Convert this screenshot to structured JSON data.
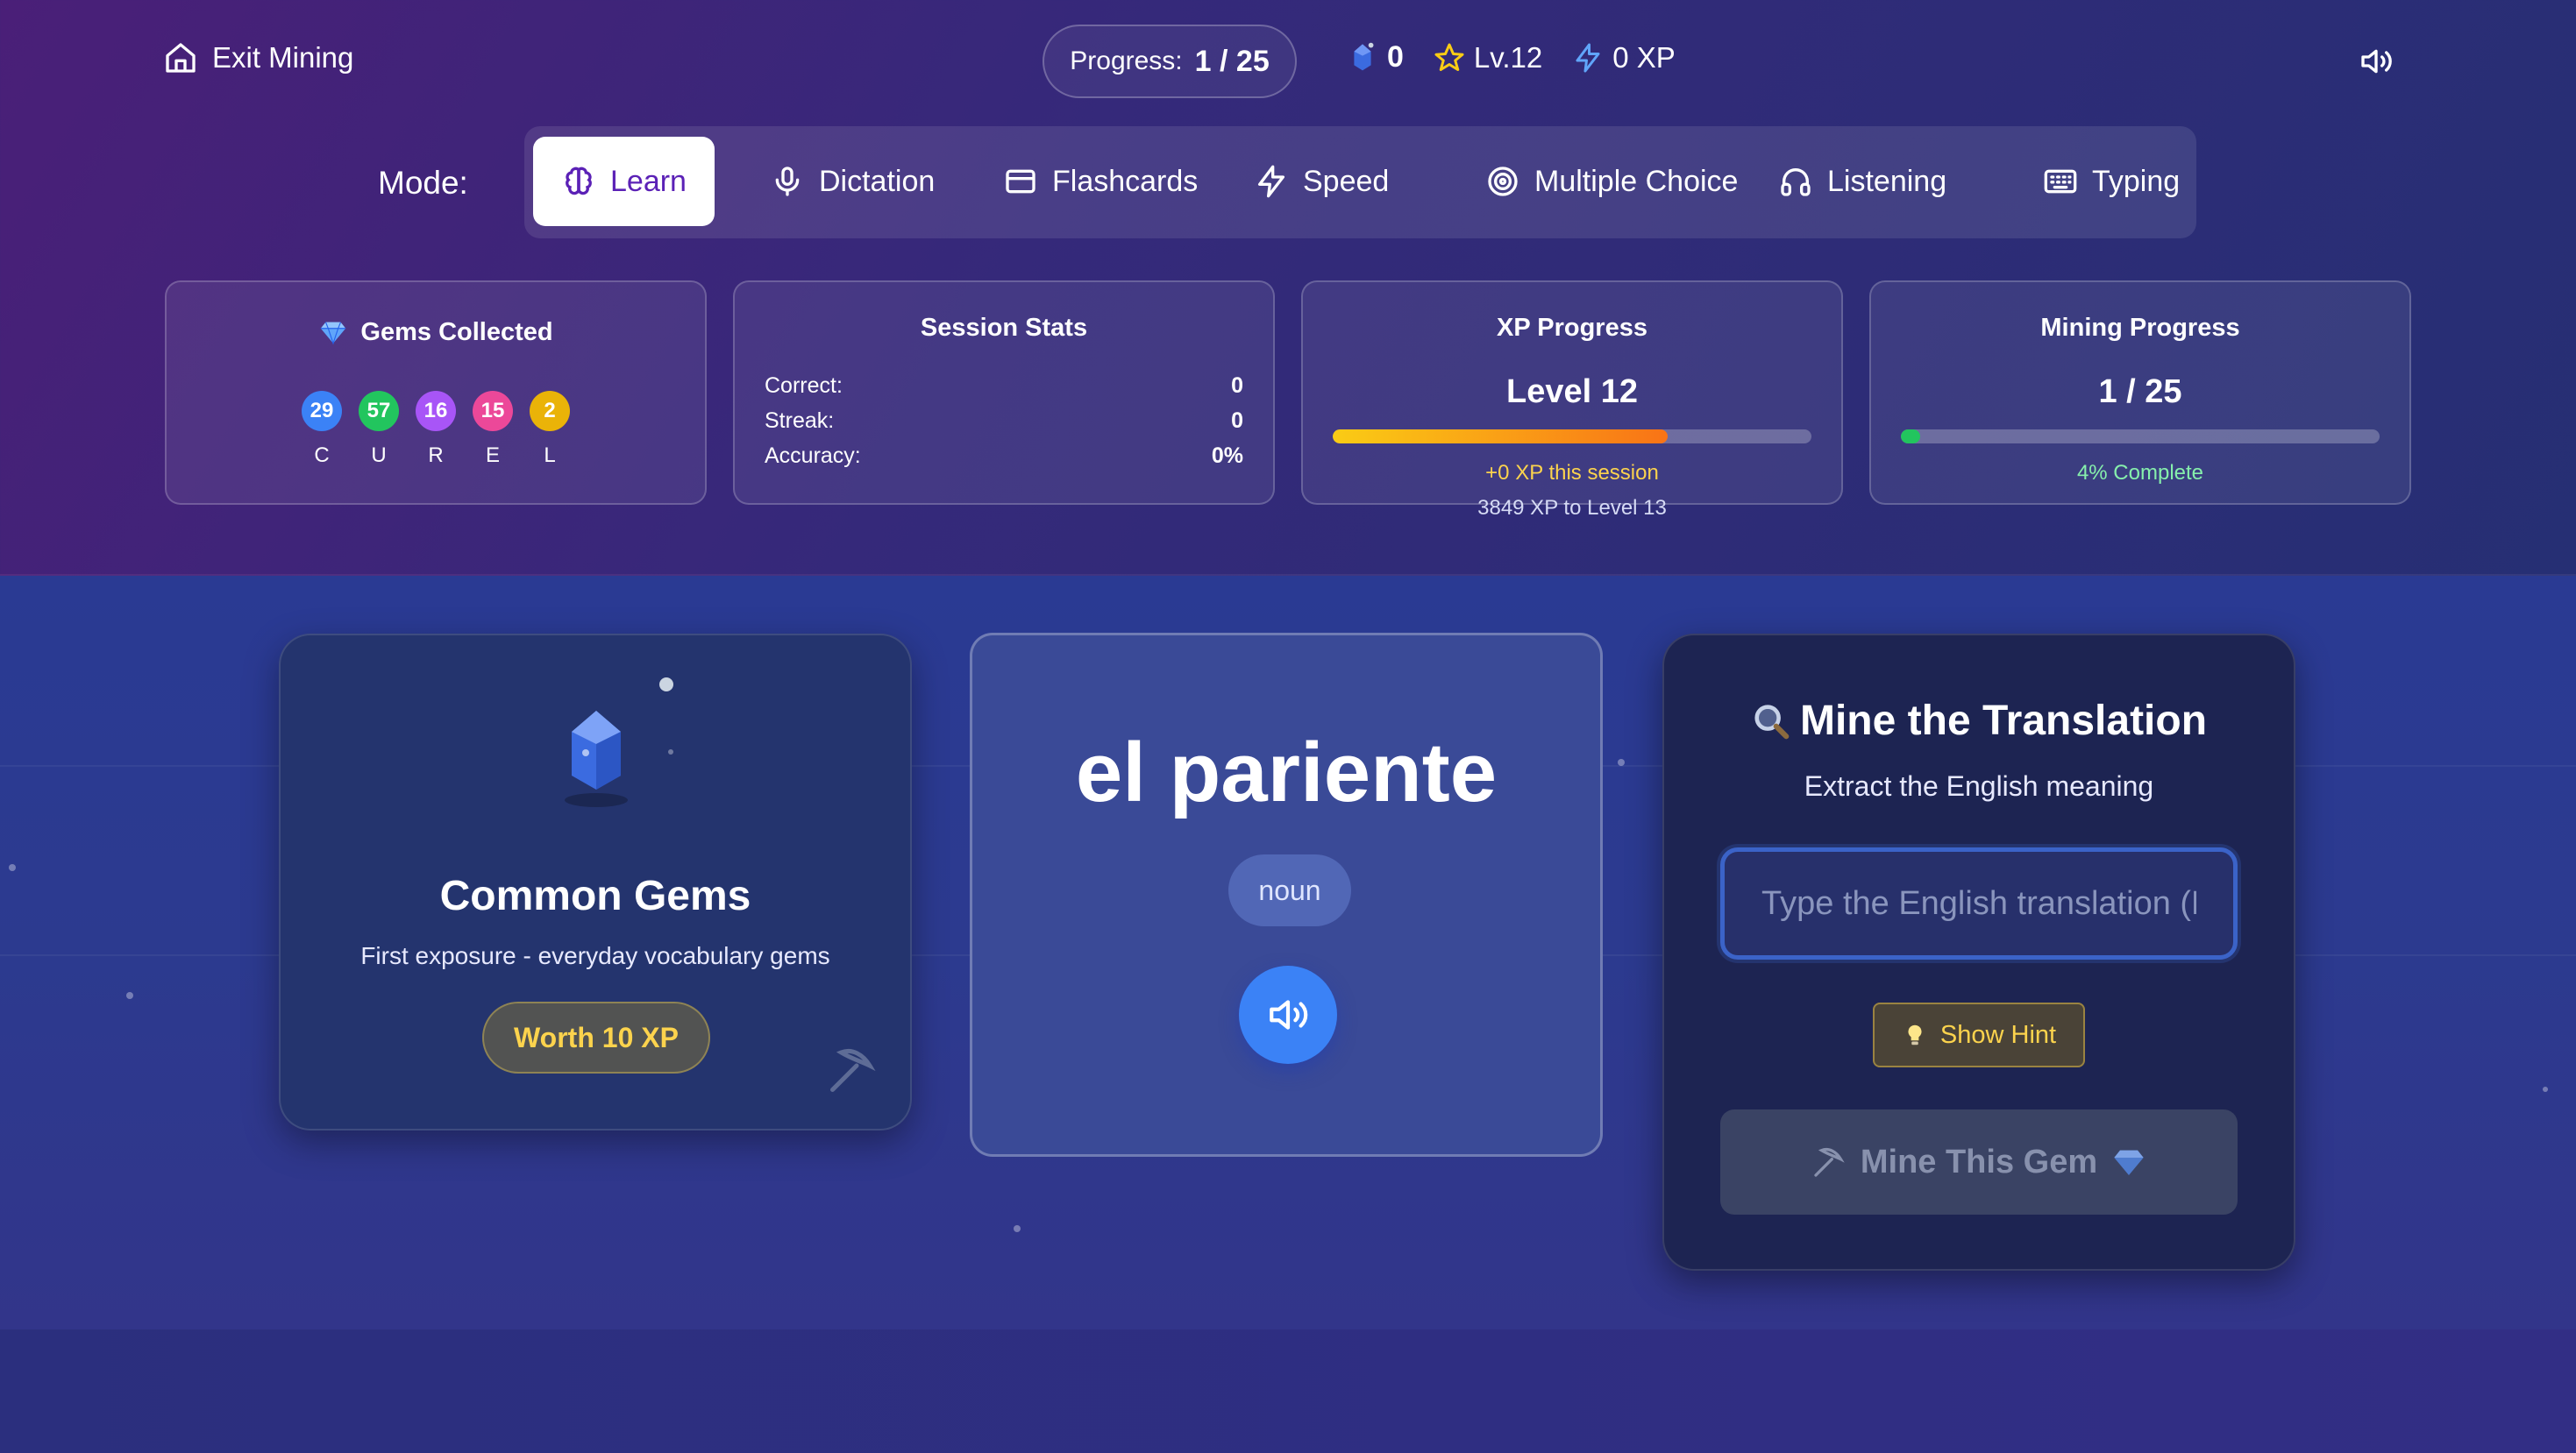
{
  "header": {
    "exit_label": "Exit Mining",
    "progress_label": "Progress:",
    "progress_value": "1 / 25",
    "gem_count": "0",
    "level_badge": "Lv.12",
    "xp_badge": "0 XP"
  },
  "modes": {
    "label": "Mode:",
    "active": "Learn",
    "items": [
      {
        "label": "Learn",
        "icon": "brain-icon"
      },
      {
        "label": "Dictation",
        "icon": "microphone-icon"
      },
      {
        "label": "Flashcards",
        "icon": "card-icon"
      },
      {
        "label": "Speed",
        "icon": "lightning-icon"
      },
      {
        "label": "Multiple Choice",
        "icon": "target-icon"
      },
      {
        "label": "Listening",
        "icon": "headphones-icon"
      },
      {
        "label": "Typing",
        "icon": "keyboard-icon"
      }
    ]
  },
  "gems_collected": {
    "title": "Gems Collected",
    "rarities": [
      {
        "count": "29",
        "letter": "C",
        "color": "#3b82f6"
      },
      {
        "count": "57",
        "letter": "U",
        "color": "#22c55e"
      },
      {
        "count": "16",
        "letter": "R",
        "color": "#a855f7"
      },
      {
        "count": "15",
        "letter": "E",
        "color": "#ec4899"
      },
      {
        "count": "2",
        "letter": "L",
        "color": "#eab308"
      }
    ]
  },
  "session_stats": {
    "title": "Session Stats",
    "rows": [
      {
        "label": "Correct:",
        "value": "0"
      },
      {
        "label": "Streak:",
        "value": "0"
      },
      {
        "label": "Accuracy:",
        "value": "0%"
      }
    ]
  },
  "xp_progress": {
    "title": "XP Progress",
    "level": "Level 12",
    "fraction": 0.7,
    "session_note": "+0 XP this session",
    "next_note": "3849 XP to Level 13"
  },
  "mining_progress": {
    "title": "Mining Progress",
    "value": "1 / 25",
    "fraction": 0.04,
    "complete_note": "4% Complete"
  },
  "gem_card": {
    "title": "Common Gems",
    "description": "First exposure - everyday vocabulary gems",
    "worth": "Worth 10 XP"
  },
  "word_card": {
    "word": "el pariente",
    "part_of_speech": "noun"
  },
  "mine_card": {
    "title": "Mine the Translation",
    "subtitle": "Extract the English meaning",
    "input_placeholder": "Type the English translation (H",
    "hint_label": "Show Hint",
    "submit_label": "Mine This Gem"
  },
  "colors": {
    "accent_purple": "#5b21b6",
    "xp_gold": "#fcd34d",
    "mining_green": "#22c55e",
    "speak_blue": "#3b82f6"
  }
}
